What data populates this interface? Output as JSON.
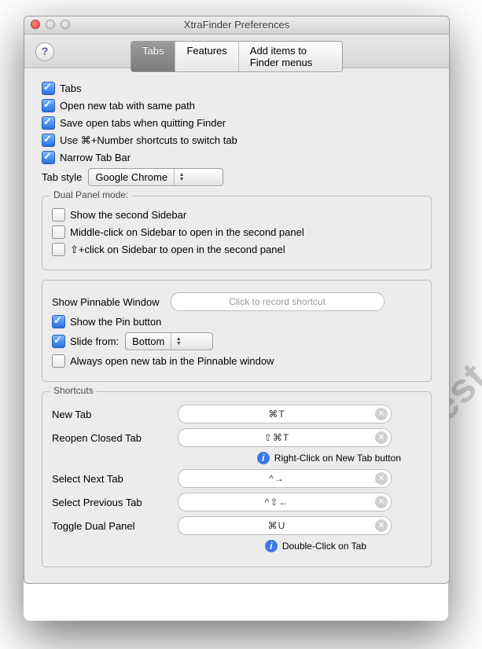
{
  "watermark": "www.best-mac-tips.com",
  "window": {
    "title": "XtraFinder Preferences"
  },
  "segments": {
    "tabs": "Tabs",
    "features": "Features",
    "additems": "Add items to Finder menus"
  },
  "main": {
    "tabs": "Tabs",
    "open_new_tab": "Open new tab with same path",
    "save_tabs": "Save open tabs when quitting Finder",
    "cmd_number": "Use ⌘+Number shortcuts to switch tab",
    "narrow": "Narrow Tab Bar",
    "tab_style_label": "Tab style",
    "tab_style_value": "Google Chrome"
  },
  "dual": {
    "title": "Dual Panel mode:",
    "second_sidebar": "Show the second Sidebar",
    "middle_click": "Middle-click on Sidebar to open in the second panel",
    "shift_click": "⇧+click on Sidebar to open in the second panel"
  },
  "pinnable": {
    "show_label": "Show Pinnable Window",
    "recorder_placeholder": "Click to record shortcut",
    "show_pin": "Show the Pin button",
    "slide_label": "Slide from:",
    "slide_value": "Bottom",
    "always_open": "Always open new tab in the Pinnable window"
  },
  "shortcuts": {
    "title": "Shortcuts",
    "new_tab_label": "New Tab",
    "new_tab_value": "⌘T",
    "reopen_label": "Reopen Closed Tab",
    "reopen_value": "⇧⌘T",
    "hint1": "Right-Click on New Tab button",
    "next_label": "Select Next Tab",
    "next_value": "^→",
    "prev_label": "Select Previous Tab",
    "prev_value": "^⇧←",
    "toggle_label": "Toggle Dual Panel",
    "toggle_value": "⌘U",
    "hint2": "Double-Click on Tab"
  }
}
